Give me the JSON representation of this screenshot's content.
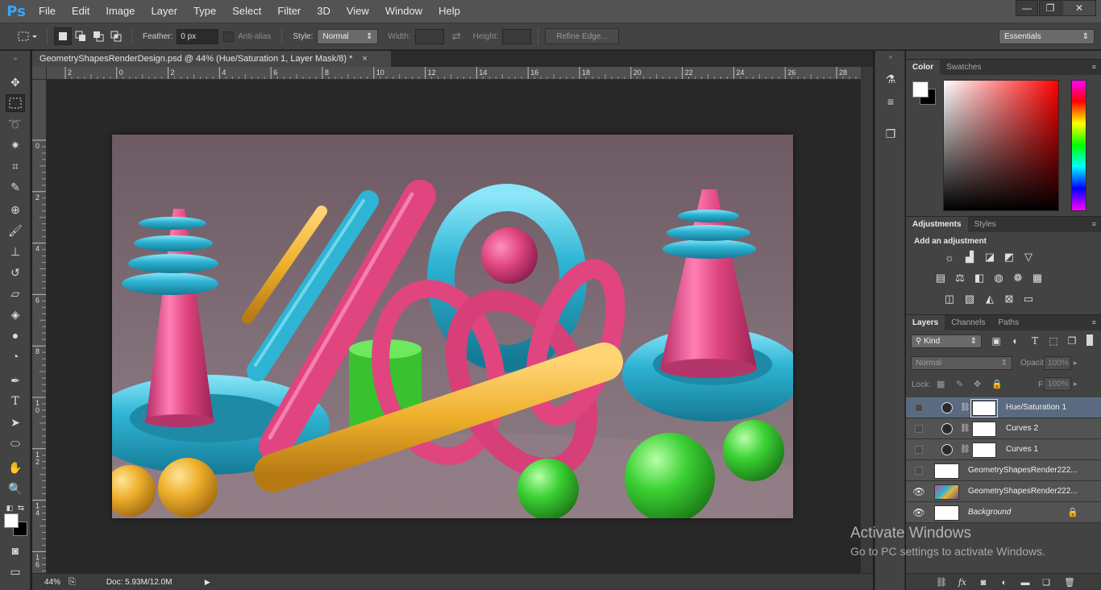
{
  "app": {
    "logo": "Ps"
  },
  "menu": [
    "File",
    "Edit",
    "Image",
    "Layer",
    "Type",
    "Select",
    "Filter",
    "3D",
    "View",
    "Window",
    "Help"
  ],
  "window_controls": {
    "minimize": "—",
    "restore": "❐",
    "close": "✕"
  },
  "options": {
    "feather_label": "Feather:",
    "feather_value": "0 px",
    "antialias_label": "Anti-alias",
    "style_label": "Style:",
    "style_value": "Normal",
    "width_label": "Width:",
    "height_label": "Height:",
    "refine_edge": "Refine Edge...",
    "workspace": "Essentials"
  },
  "document_tab": {
    "title": "GeometryShapesRenderDesign.psd @ 44% (Hue/Saturation 1, Layer Mask/8) *",
    "close": "×"
  },
  "ruler": {
    "horizontal": [
      "2",
      "0",
      "2",
      "4",
      "6",
      "8",
      "10",
      "12",
      "14",
      "16",
      "18",
      "20",
      "22",
      "24",
      "26",
      "28"
    ],
    "vertical": [
      "0",
      "2",
      "4",
      "6",
      "8",
      "1\n0",
      "1\n2",
      "1\n4",
      "1\n6"
    ]
  },
  "status": {
    "zoom": "44%",
    "doc_info": "Doc: 5.93M/12.0M"
  },
  "panels": {
    "color_tabs": [
      "Color",
      "Swatches"
    ],
    "adjust_tabs": [
      "Adjustments",
      "Styles"
    ],
    "adjust_title": "Add an adjustment",
    "layers_tabs": [
      "Layers",
      "Channels",
      "Paths"
    ],
    "layers_filter": "Kind",
    "blend_mode": "Normal",
    "opacity_label": "Opacity:",
    "opacity_value": "100%",
    "lock_label": "Lock:",
    "fill_label": "Fill:",
    "fill_value": "100%"
  },
  "layers": [
    {
      "name": "Hue/Saturation 1",
      "visible": false,
      "selected": true,
      "kind": "adjustment"
    },
    {
      "name": "Curves 2",
      "visible": false,
      "selected": false,
      "kind": "adjustment"
    },
    {
      "name": "Curves 1",
      "visible": false,
      "selected": false,
      "kind": "adjustment"
    },
    {
      "name": "GeometryShapesRender222...",
      "visible": false,
      "selected": false,
      "kind": "smart"
    },
    {
      "name": "GeometryShapesRender222...",
      "visible": true,
      "selected": false,
      "kind": "smart-image"
    },
    {
      "name": "Background",
      "visible": true,
      "selected": false,
      "kind": "background"
    }
  ],
  "activation": {
    "title": "Activate Windows",
    "subtitle": "Go to PC settings to activate Windows."
  },
  "colors": {
    "ui_dark": "#434343",
    "menubar": "#535353",
    "ps_blue": "#31a8ff",
    "selected_layer": "#5a6a80",
    "art_background": "#7a6670",
    "pink": "#e0457f",
    "cyan": "#2eb4d4",
    "yellow": "#eeb02c",
    "green": "#3cd234"
  }
}
